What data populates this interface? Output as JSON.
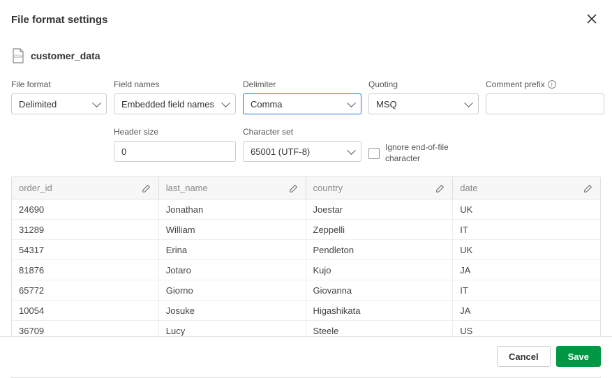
{
  "dialog": {
    "title": "File format settings",
    "file_name": "customer_data"
  },
  "fields": {
    "file_format": {
      "label": "File format",
      "value": "Delimited"
    },
    "field_names": {
      "label": "Field names",
      "value": "Embedded field names"
    },
    "delimiter": {
      "label": "Delimiter",
      "value": "Comma"
    },
    "quoting": {
      "label": "Quoting",
      "value": "MSQ"
    },
    "comment_prefix": {
      "label": "Comment prefix",
      "value": ""
    },
    "header_size": {
      "label": "Header size",
      "value": "0"
    },
    "character_set": {
      "label": "Character set",
      "value": "65001 (UTF-8)"
    },
    "ignore_eof": {
      "label": "Ignore end-of-file character",
      "checked": false
    }
  },
  "table": {
    "columns": [
      "order_id",
      "last_name",
      "country",
      "date"
    ],
    "rows": [
      [
        "24690",
        "Jonathan",
        "Joestar",
        "UK"
      ],
      [
        "31289",
        "William",
        "Zeppelli",
        "IT"
      ],
      [
        "54317",
        "Erina",
        "Pendleton",
        "UK"
      ],
      [
        "81876",
        "Jotaro",
        "Kujo",
        "JA"
      ],
      [
        "65772",
        "Giorno",
        "Giovanna",
        "IT"
      ],
      [
        "10054",
        "Josuke",
        "Higashikata",
        "JA"
      ],
      [
        "36709",
        "Lucy",
        "Steele",
        "US"
      ]
    ]
  },
  "footer": {
    "cancel": "Cancel",
    "save": "Save"
  }
}
